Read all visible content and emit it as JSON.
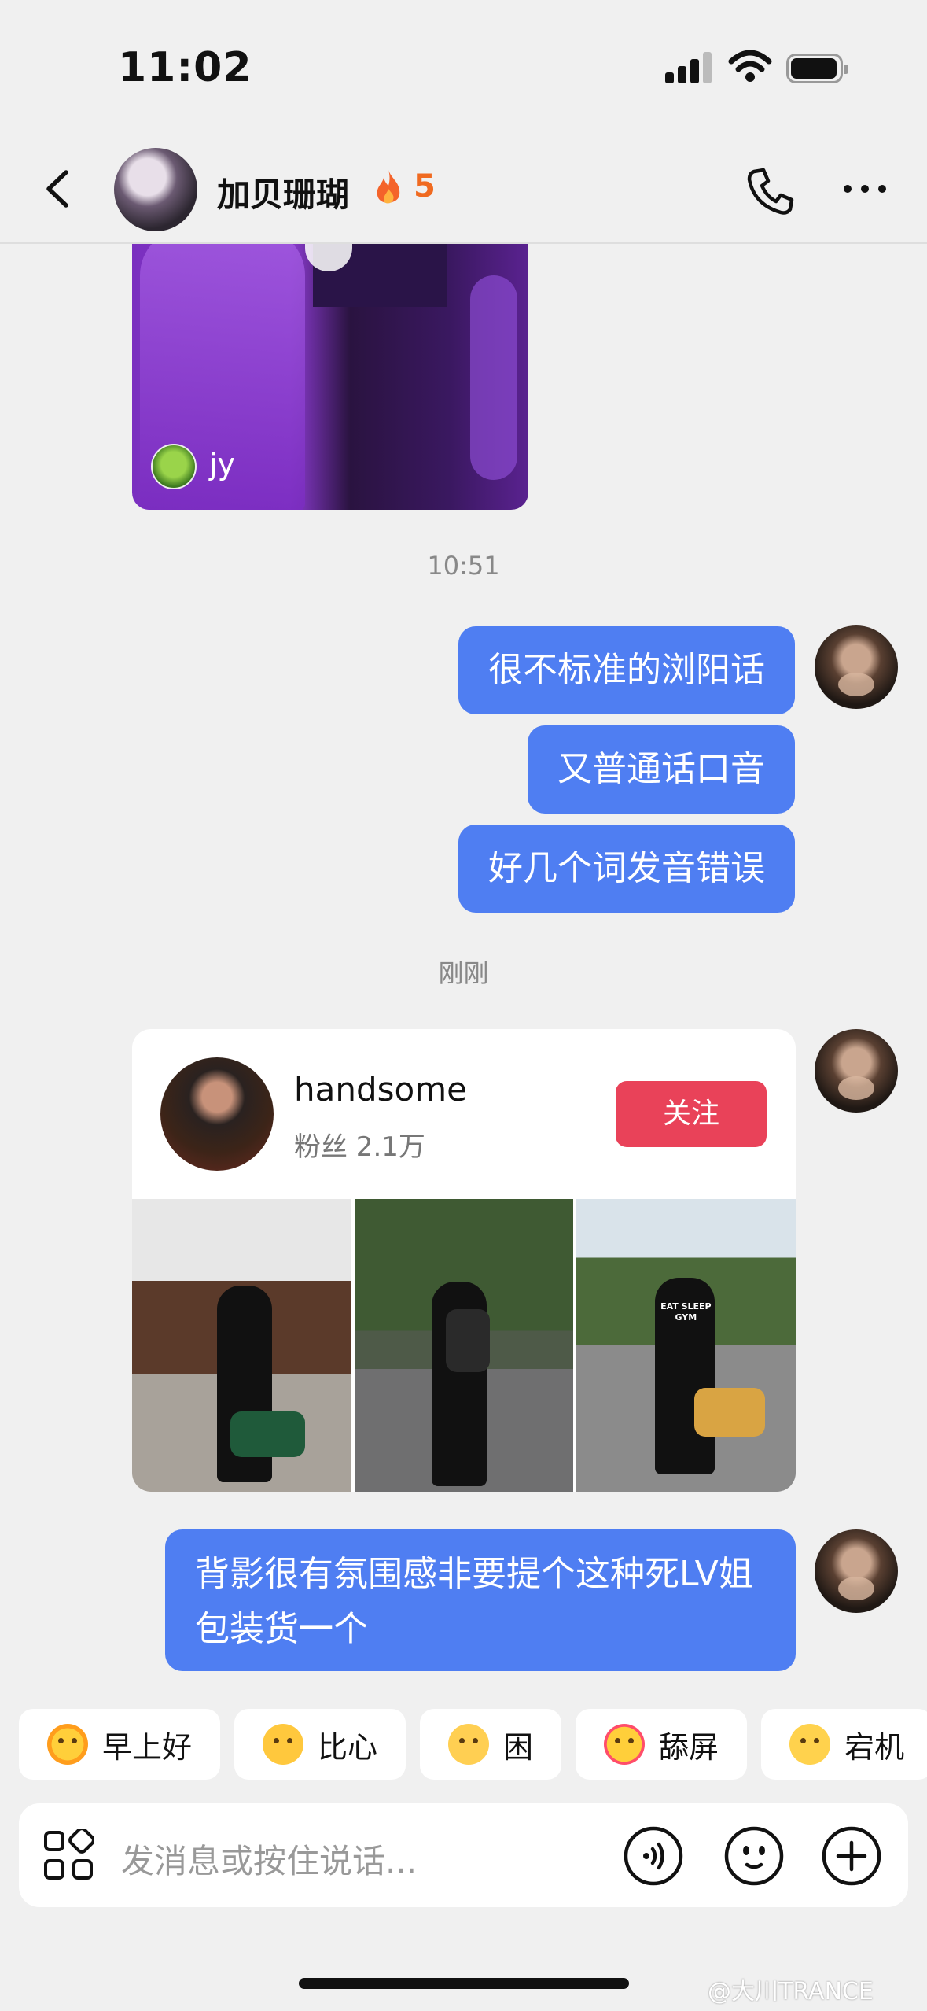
{
  "status_bar": {
    "time": "11:02"
  },
  "header": {
    "contact_name": "加贝珊瑚",
    "streak_count": "5",
    "icons": [
      "back-arrow-icon",
      "fire-icon",
      "phone-icon",
      "more-icon"
    ]
  },
  "shared_video": {
    "sharer_name": "jy"
  },
  "timestamps": {
    "first": "10:51",
    "second": "刚刚"
  },
  "messages": [
    {
      "sender": "me",
      "text": "很不标准的浏阳话"
    },
    {
      "sender": "me",
      "text": "又普通话口音"
    },
    {
      "sender": "me",
      "text": "好几个词发音错误"
    },
    {
      "sender": "me",
      "text": "背影很有氛围感非要提个这种死LV姐包装货一个"
    }
  ],
  "profile_card": {
    "username": "handsome",
    "fans": "粉丝 2.1万",
    "follow_label": "关注",
    "photo3_shirt_text": "EAT SLEEP GYM"
  },
  "quick_replies": [
    {
      "label": "早上好",
      "emoji": "sun-face-icon"
    },
    {
      "label": "比心",
      "emoji": "heart-hand-icon"
    },
    {
      "label": "困",
      "emoji": "sleepy-face-icon"
    },
    {
      "label": "舔屏",
      "emoji": "heart-eyes-icon"
    },
    {
      "label": "宕机",
      "emoji": "dizzy-face-icon"
    }
  ],
  "input": {
    "placeholder": "发消息或按住说话..."
  },
  "watermark": "@大川TRANCE",
  "colors": {
    "bubble": "#4f7ef2",
    "follow": "#e94259",
    "streak": "#f06a20",
    "background": "#f0f0f0"
  }
}
